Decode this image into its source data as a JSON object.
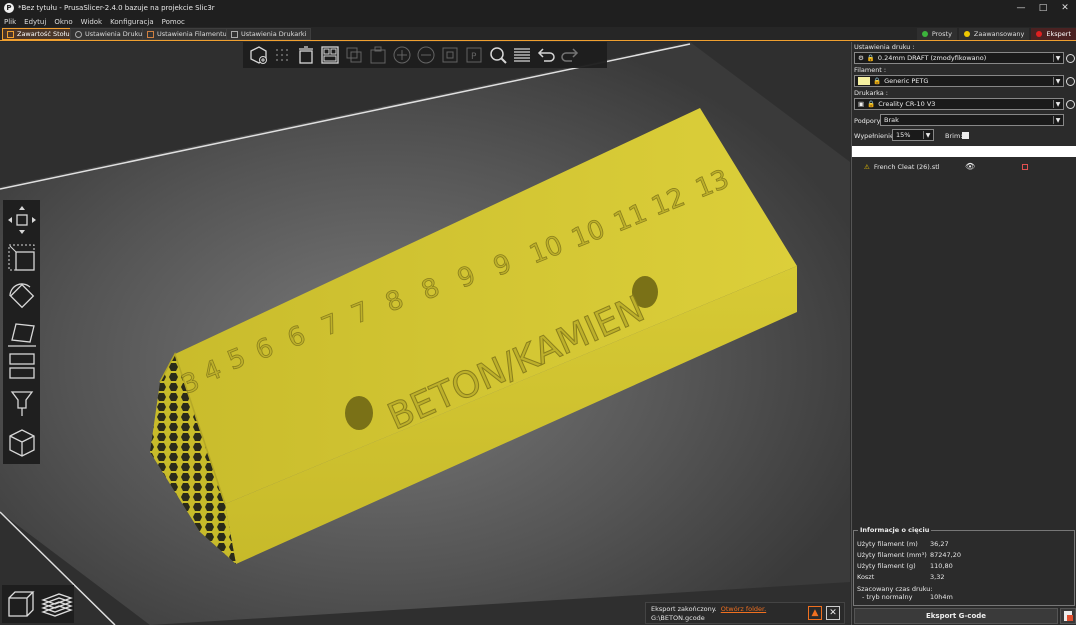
{
  "window": {
    "title": "*Bez tytułu - PrusaSlicer-2.4.0 bazuje na projekcie Slic3r"
  },
  "menu": [
    "Plik",
    "Edytuj",
    "Okno",
    "Widok",
    "Konfiguracja",
    "Pomoc"
  ],
  "tabs": [
    "Zawartość Stołu",
    "Ustawienia Druku",
    "Ustawienia Filamentu",
    "Ustawienia Drukarki"
  ],
  "modes": [
    {
      "label": "Prosty",
      "color": "#3cb43c"
    },
    {
      "label": "Zaawansowany",
      "color": "#f0c800"
    },
    {
      "label": "Ekspert",
      "color": "#e02020"
    }
  ],
  "model": {
    "numbers": [
      "3",
      "4",
      "5",
      "6",
      "6",
      "7",
      "7",
      "8",
      "8",
      "9",
      "9",
      "10",
      "10",
      "11",
      "12",
      "13"
    ],
    "side_text": "BETON/KAMIEN",
    "color": "#d4c731"
  },
  "sidebar": {
    "print_label": "Ustawienia druku :",
    "print_value": "0.24mm DRAFT (zmodyfikowano)",
    "filament_label": "Filament :",
    "filament_value": "Generic PETG",
    "filament_color": "#f5f0a0",
    "printer_label": "Drukarka :",
    "printer_value": "Creality CR-10 V3",
    "supports_label": "Podpory:",
    "supports_value": "Brak",
    "infill_label": "Wypełnienie:",
    "infill_value": "15%",
    "brim_label": "Brim:",
    "object_name": "French Cleat (26).stl"
  },
  "info": {
    "title": "Informacje o cięciu",
    "rows": [
      {
        "label": "Użyty filament (m)",
        "value": "36,27"
      },
      {
        "label": "Użyty filament (mm³)",
        "value": "87247,20"
      },
      {
        "label": "Użyty filament (g)",
        "value": "110,80"
      },
      {
        "label": "Koszt",
        "value": "3,32"
      }
    ],
    "time_label": "Szacowany czas druku:",
    "time_mode": "- tryb normalny",
    "time_value": "10h4m"
  },
  "export_button": "Eksport G-code",
  "notification": {
    "line1": "Eksport zakończony.",
    "link": "Otwórz folder.",
    "line2": "G:\\BETON.gcode"
  }
}
